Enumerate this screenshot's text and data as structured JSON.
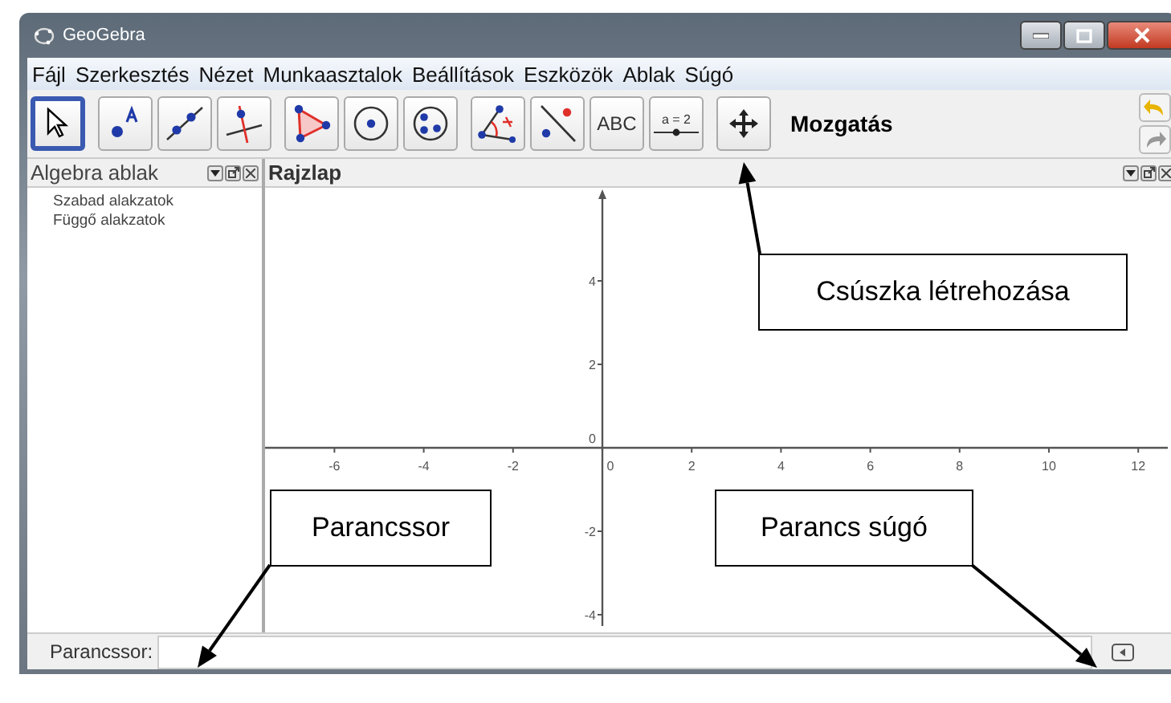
{
  "window": {
    "title": "GeoGebra"
  },
  "menu": [
    "Fájl",
    "Szerkesztés",
    "Nézet",
    "Munkaasztalok",
    "Beállítások",
    "Eszközök",
    "Ablak",
    "Súgó"
  ],
  "toolbar": {
    "groups": [
      [
        {
          "kind": "move",
          "selected": true
        }
      ],
      [
        {
          "kind": "point",
          "selected": false
        },
        {
          "kind": "line",
          "selected": false
        },
        {
          "kind": "perpendicular",
          "selected": false
        }
      ],
      [
        {
          "kind": "polygon",
          "selected": false
        },
        {
          "kind": "circle",
          "selected": false
        },
        {
          "kind": "conic",
          "selected": false
        }
      ],
      [
        {
          "kind": "angle",
          "selected": false
        },
        {
          "kind": "reflect",
          "selected": false
        },
        {
          "kind": "text",
          "label": "ABC",
          "selected": false
        },
        {
          "kind": "slider",
          "label": "a = 2",
          "selected": false
        }
      ],
      [
        {
          "kind": "move-view",
          "selected": false
        }
      ]
    ],
    "tool_name": "Mozgatás"
  },
  "algebra": {
    "title": "Algebra ablak",
    "items": [
      "Szabad alakzatok",
      "Függő alakzatok"
    ]
  },
  "graphics": {
    "title": "Rajzlap",
    "x_ticks": [
      "-6",
      "-4",
      "-2",
      "0",
      "2",
      "4",
      "6",
      "8",
      "10",
      "12"
    ],
    "y_ticks": [
      "4",
      "2",
      "0",
      "-2",
      "-4"
    ]
  },
  "input_bar": {
    "label": "Parancssor:"
  },
  "annotations": [
    {
      "text": "Csúszka létrehozása",
      "kind": "slider"
    },
    {
      "text": "Parancssor",
      "kind": "input"
    },
    {
      "text": "Parancs súgó",
      "kind": "help"
    }
  ]
}
